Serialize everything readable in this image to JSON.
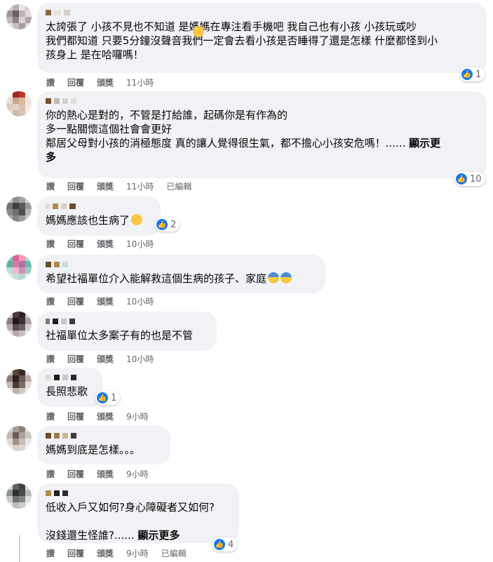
{
  "comments": [
    {
      "text": "太誇張了 小孩不見也不知道 是媽媽在專注看手機吧 我自己也有小孩 小孩玩或吵\n我們都知道 只要5分鐘沒聲音我們一定會去看小孩是否睡得了還是怎樣 什麼都怪到小\n孩身上 是在哈囉嗎！",
      "emoji": "face-with-hand-over-mouth",
      "reactions": "1",
      "actions": {
        "like": "讚",
        "reply": "回覆",
        "award": "頒獎",
        "time": "11小時",
        "edited": ""
      }
    },
    {
      "text": "你的熱心是對的，不管是打給誰，起碼你是有作為的\n多一點關懷這個社會會更好\n鄰居父母對小孩的消極態度 真的讓人覺得很生氣，都不擔心小孩安危嗎！......",
      "see_more": "顯示更\n多",
      "reactions": "10",
      "actions": {
        "like": "讚",
        "reply": "回覆",
        "award": "頒獎",
        "time": "11小時",
        "edited": "已編輯"
      }
    },
    {
      "text": "媽媽應該也生病了",
      "emoji": "rolling-eyes-face",
      "reactions": "2",
      "actions": {
        "like": "讚",
        "reply": "回覆",
        "award": "頒獎",
        "time": "10小時",
        "edited": ""
      }
    },
    {
      "text": "希望社福單位介入能解救這個生病的孩子、家庭",
      "emoji": "anxious-face-with-sweat",
      "reactions": "",
      "actions": {
        "like": "讚",
        "reply": "回覆",
        "award": "頒獎",
        "time": "10小時",
        "edited": ""
      }
    },
    {
      "text": "社福單位太多案子有的也是不管",
      "reactions": "",
      "actions": {
        "like": "讚",
        "reply": "回覆",
        "award": "頒獎",
        "time": "10小時",
        "edited": ""
      }
    },
    {
      "text": "長照悲歌",
      "reactions": "1",
      "actions": {
        "like": "讚",
        "reply": "回覆",
        "award": "頒獎",
        "time": "9小時",
        "edited": ""
      }
    },
    {
      "text": "媽媽到底是怎樣。。。",
      "reactions": "",
      "actions": {
        "like": "讚",
        "reply": "回覆",
        "award": "頒獎",
        "time": "9小時",
        "edited": ""
      }
    },
    {
      "text": "低收入戶又如何?身心障礙者又如何?\n\n沒錢還生怪誰?......",
      "see_more": "顯示更多",
      "reactions": "4",
      "actions": {
        "like": "讚",
        "reply": "回覆",
        "award": "頒獎",
        "time": "9小時",
        "edited": "已編輯"
      }
    }
  ],
  "colors": {
    "like_blue": "#1877f2",
    "bubble": "#f0f2f5",
    "meta": "#65676b"
  }
}
